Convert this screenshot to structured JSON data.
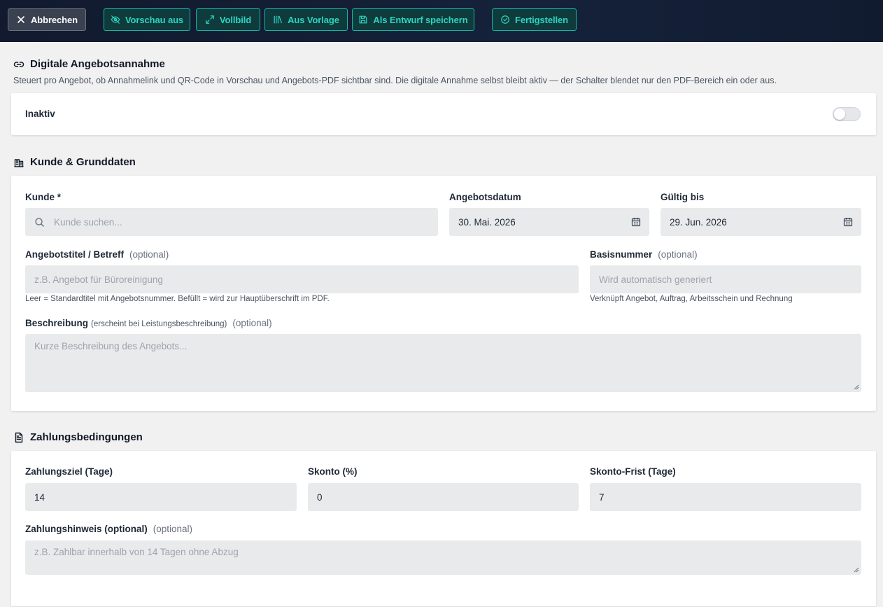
{
  "toolbar": {
    "cancel": "Abbrechen",
    "preview_off": "Vorschau aus",
    "fullscreen": "Vollbild",
    "from_template": "Aus Vorlage",
    "save_draft": "Als Entwurf speichern",
    "finish": "Fertigstellen"
  },
  "digital": {
    "title": "Digitale Angebotsannahme",
    "description": "Steuert pro Angebot, ob Annahmelink und QR-Code in Vorschau und Angebots-PDF sichtbar sind. Die digitale Annahme selbst bleibt aktiv — der Schalter blendet nur den PDF-Bereich ein oder aus.",
    "status_label": "Inaktiv",
    "enabled": false
  },
  "customer": {
    "title": "Kunde & Grunddaten",
    "kunde_label": "Kunde *",
    "kunde_placeholder": "Kunde suchen...",
    "date_label": "Angebotsdatum",
    "date_value": "30. Mai. 2026",
    "valid_label": "Gültig bis",
    "valid_value": "29. Jun. 2026",
    "subject_label": "Angebotstitel / Betreff",
    "optional": "(optional)",
    "subject_placeholder": "z.B. Angebot für Büroreinigung",
    "subject_hint": "Leer = Standardtitel mit Angebotsnummer. Befüllt = wird zur Hauptüberschrift im PDF.",
    "base_label": "Basisnummer",
    "base_placeholder": "Wird automatisch generiert",
    "base_hint": "Verknüpft Angebot, Auftrag, Arbeitsschein und Rechnung",
    "desc_label": "Beschreibung",
    "desc_small": "(erscheint bei Leistungsbeschreibung)",
    "desc_placeholder": "Kurze Beschreibung des Angebots..."
  },
  "payment": {
    "title": "Zahlungsbedingungen",
    "term_label": "Zahlungsziel (Tage)",
    "term_value": "14",
    "discount_label": "Skonto (%)",
    "discount_value": "0",
    "discount_days_label": "Skonto-Frist (Tage)",
    "discount_days_value": "7",
    "note_label": "Zahlungshinweis (optional)",
    "optional": "(optional)",
    "note_placeholder": "z.B. Zahlbar innerhalb von 14 Tagen ohne Abzug"
  }
}
